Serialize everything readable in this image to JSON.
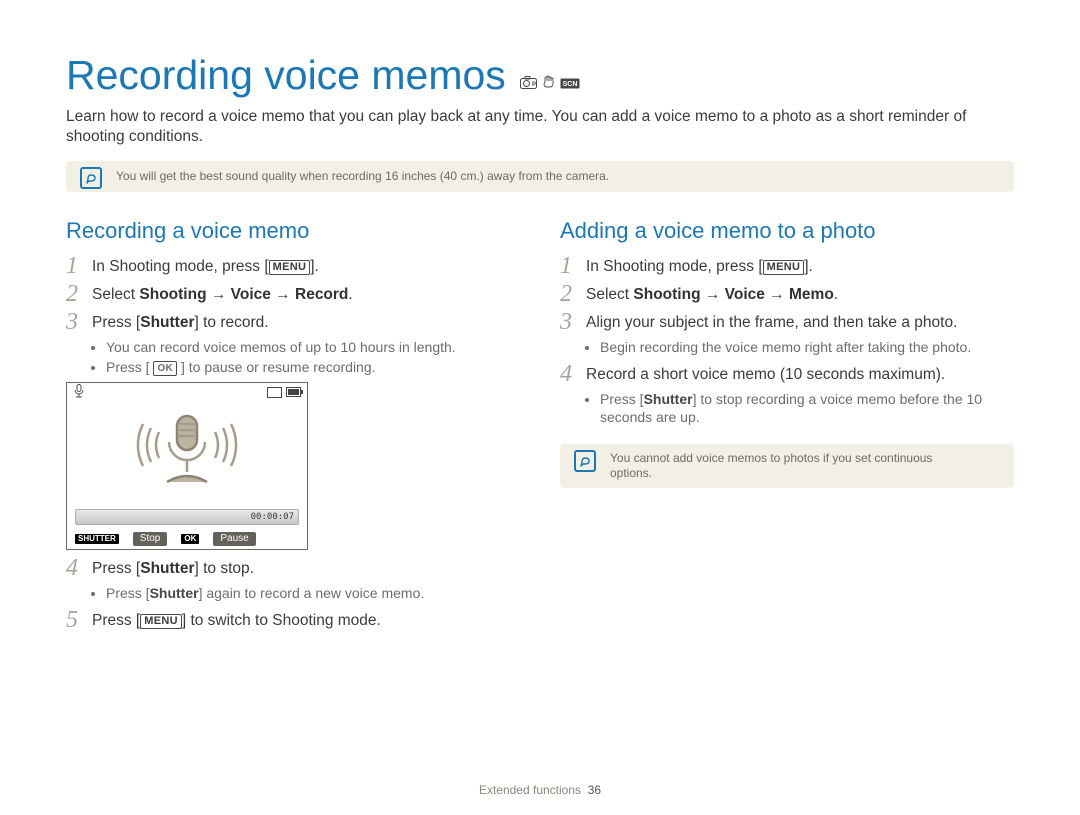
{
  "title": "Recording voice memos",
  "mode_icons": [
    "camera-p-icon",
    "hand-icon",
    "scn-icon"
  ],
  "intro": "Learn how to record a voice memo that you can play back at any time. You can add a voice memo to a photo as a short reminder of shooting conditions.",
  "tip_main": "You will get the best sound quality when recording 16 inches (40 cm.) away from the camera.",
  "left": {
    "heading": "Recording a voice memo",
    "step1_a": "In Shooting mode, press [",
    "step1_b": "].",
    "menu_label": "MENU",
    "step2_a": "Select ",
    "step2_b": "Shooting",
    "step2_c": " → ",
    "step2_d": "Voice",
    "step2_e": " → ",
    "step2_f": "Record",
    "step2_g": ".",
    "step3_a": "Press [",
    "step3_b": "Shutter",
    "step3_c": "] to record.",
    "sub3_a": "You can record voice memos of up to 10 hours in length.",
    "sub3_b_a": "Press [ ",
    "sub3_b_b": " ] to pause or resume recording.",
    "ok_label": "OK",
    "screen": {
      "time": "00:00:07",
      "shutter_label": "SHUTTER",
      "stop": "Stop",
      "ok_label": "OK",
      "pause": "Pause"
    },
    "step4_a": "Press [",
    "step4_b": "Shutter",
    "step4_c": "] to stop.",
    "sub4_a": "Press [",
    "sub4_b": "Shutter",
    "sub4_c": "] again to record a new voice memo.",
    "step5_a": "Press [",
    "step5_b": "] to switch to Shooting mode."
  },
  "right": {
    "heading": "Adding a voice memo to a photo",
    "step1_a": "In Shooting mode, press [",
    "step1_b": "].",
    "menu_label": "MENU",
    "step2_a": "Select ",
    "step2_b": "Shooting",
    "step2_c": " → ",
    "step2_d": "Voice",
    "step2_e": " → ",
    "step2_f": "Memo",
    "step2_g": ".",
    "step3": "Align your subject in the frame, and then take a photo.",
    "sub3": "Begin recording the voice memo right after taking the photo.",
    "step4": "Record a short voice memo (10 seconds maximum).",
    "sub4_a": "Press [",
    "sub4_b": "Shutter",
    "sub4_c": "] to stop recording a voice memo before the 10 seconds are up.",
    "tip": "You cannot add voice memos to photos if you set continuous options."
  },
  "footer_section": "Extended functions",
  "footer_page": "36"
}
